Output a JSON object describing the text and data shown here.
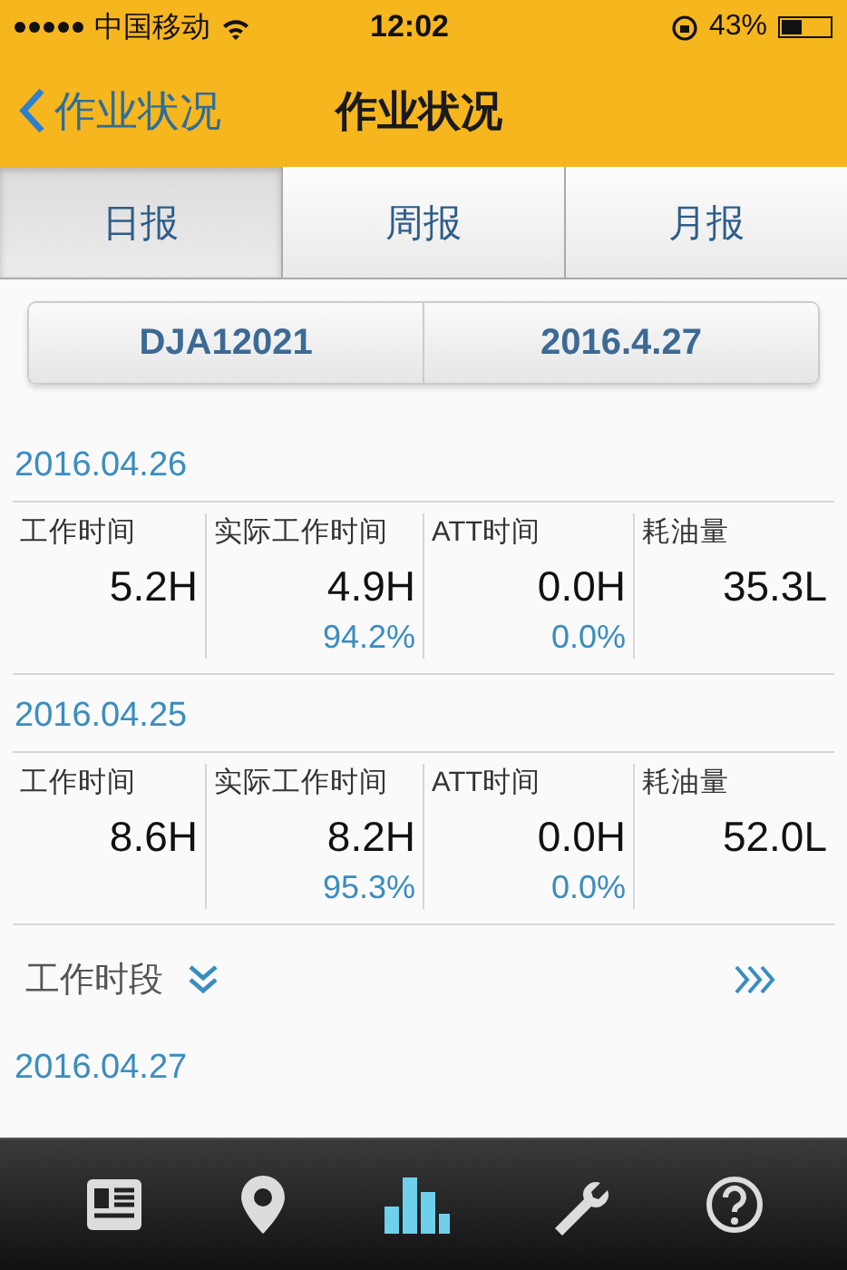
{
  "status_bar": {
    "carrier": "中国移动",
    "time": "12:02",
    "battery": "43%"
  },
  "nav": {
    "back_label": "作业状况",
    "title": "作业状况"
  },
  "tabs": [
    {
      "label": "日报",
      "selected": true
    },
    {
      "label": "周报",
      "selected": false
    },
    {
      "label": "月报",
      "selected": false
    }
  ],
  "selector": {
    "machine": "DJA12021",
    "date": "2016.4.27"
  },
  "reports": [
    {
      "date": "2016.04.26",
      "metrics": [
        {
          "label": "工作时间",
          "value": "5.2H"
        },
        {
          "label": "实际工作时间",
          "value": "4.9H",
          "percent": "94.2%"
        },
        {
          "label": "ATT时间",
          "value": "0.0H",
          "percent": "0.0%"
        },
        {
          "label": "耗油量",
          "value": "35.3L"
        }
      ]
    },
    {
      "date": "2016.04.25",
      "metrics": [
        {
          "label": "工作时间",
          "value": "8.6H"
        },
        {
          "label": "实际工作时间",
          "value": "8.2H",
          "percent": "95.3%"
        },
        {
          "label": "ATT时间",
          "value": "0.0H",
          "percent": "0.0%"
        },
        {
          "label": "耗油量",
          "value": "52.0L"
        }
      ]
    }
  ],
  "section": {
    "label": "工作时段"
  },
  "next_date": "2016.04.27",
  "tab_bar": [
    {
      "kind": "report",
      "selected": false
    },
    {
      "kind": "location",
      "selected": false
    },
    {
      "kind": "chart",
      "selected": true
    },
    {
      "kind": "tools",
      "selected": false
    },
    {
      "kind": "help",
      "selected": false
    }
  ]
}
